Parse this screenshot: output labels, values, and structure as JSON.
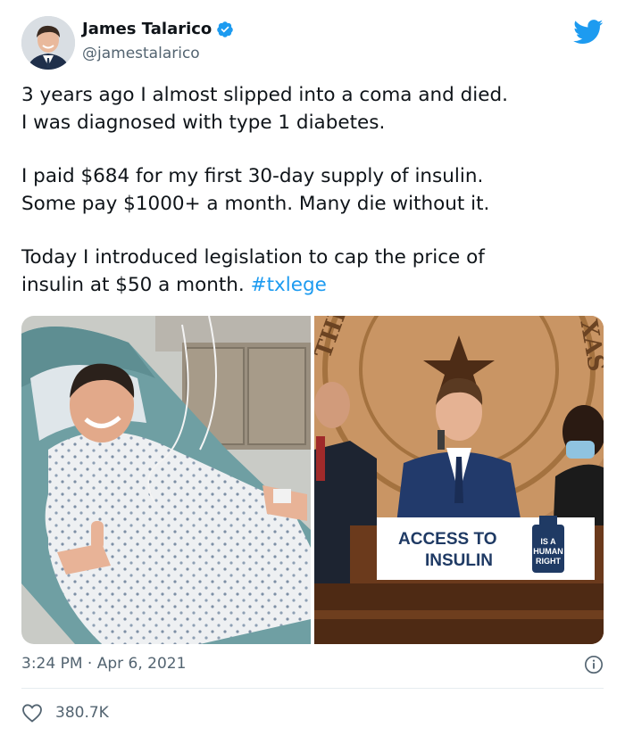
{
  "author": {
    "display_name": "James Talarico",
    "handle": "@jamestalarico",
    "verified": true
  },
  "tweet": {
    "lines": [
      "3 years ago I almost slipped into a coma and died.",
      "I was diagnosed with type 1 diabetes.",
      "I paid $684 for my first 30-day supply of insulin.",
      "Some pay $1000+ a month. Many die without it.",
      "Today I introduced legislation to cap the price of",
      "insulin at $50 a month. "
    ],
    "hashtag": "#txlege"
  },
  "media": {
    "sign_line1": "ACCESS TO",
    "sign_line2": "INSULIN",
    "badge_line1": "IS A",
    "badge_line2": "HUMAN",
    "badge_line3": "RIGHT",
    "seal_left": "THE",
    "seal_right": "XAS"
  },
  "meta": {
    "timestamp": "3:24 PM · Apr 6, 2021"
  },
  "actions": {
    "like_count": "380.7K"
  },
  "colors": {
    "accent": "#1d9bf0",
    "text": "#0f1419",
    "secondary": "#536471"
  },
  "icons": [
    "verified-badge-icon",
    "twitter-bird-icon",
    "info-icon",
    "heart-icon"
  ]
}
